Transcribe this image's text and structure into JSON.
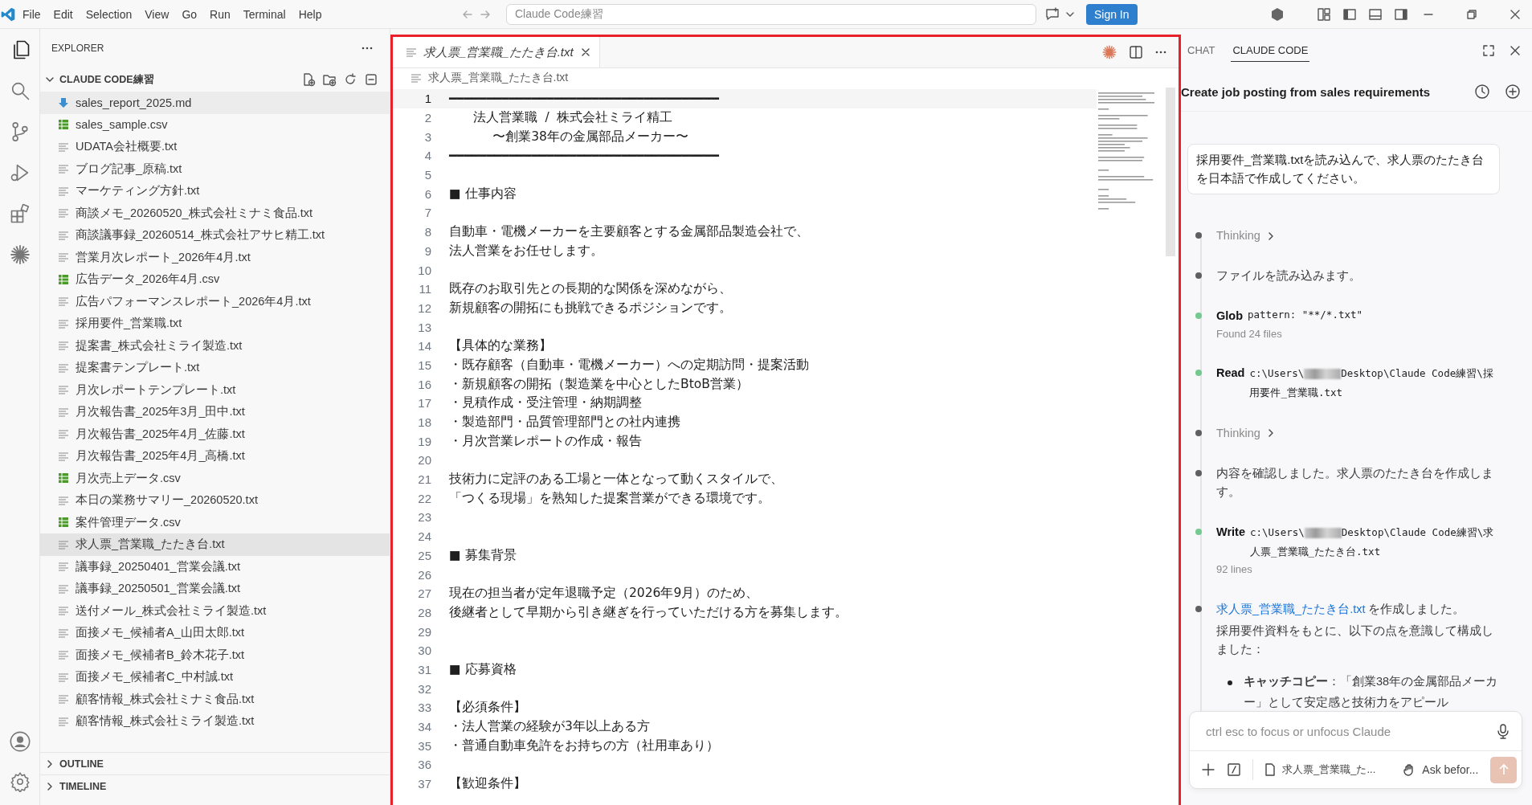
{
  "title_bar": {
    "menus": [
      "File",
      "Edit",
      "Selection",
      "View",
      "Go",
      "Run",
      "Terminal",
      "Help"
    ],
    "search": "Claude Code練習",
    "sign_in": "Sign In"
  },
  "activity_bar": {
    "items": [
      {
        "kind": "explorer",
        "selected": true
      },
      {
        "kind": "search",
        "selected": false
      },
      {
        "kind": "source-control",
        "selected": false
      },
      {
        "kind": "run",
        "selected": false
      },
      {
        "kind": "extensions",
        "selected": false
      },
      {
        "kind": "claude",
        "selected": false
      }
    ]
  },
  "explorer": {
    "title": "EXPLORER",
    "folder": {
      "name": "CLAUDE CODE練習",
      "expanded": true,
      "files": [
        {
          "name": "sales_report_2025.md",
          "kind": "md",
          "selected": false,
          "hovered": true
        },
        {
          "name": "sales_sample.csv",
          "kind": "csv",
          "selected": false,
          "hovered": false
        },
        {
          "name": "UDATA会社概要.txt",
          "kind": "txt",
          "selected": false,
          "hovered": false
        },
        {
          "name": "ブログ記事_原稿.txt",
          "kind": "txt",
          "selected": false,
          "hovered": false
        },
        {
          "name": "マーケティング方針.txt",
          "kind": "txt",
          "selected": false,
          "hovered": false
        },
        {
          "name": "商談メモ_20260520_株式会社ミナミ食品.txt",
          "kind": "txt",
          "selected": false,
          "hovered": false
        },
        {
          "name": "商談議事録_20260514_株式会社アサヒ精工.txt",
          "kind": "txt",
          "selected": false,
          "hovered": false
        },
        {
          "name": "営業月次レポート_2026年4月.txt",
          "kind": "txt",
          "selected": false,
          "hovered": false
        },
        {
          "name": "広告データ_2026年4月.csv",
          "kind": "csv",
          "selected": false,
          "hovered": false
        },
        {
          "name": "広告パフォーマンスレポート_2026年4月.txt",
          "kind": "txt",
          "selected": false,
          "hovered": false
        },
        {
          "name": "採用要件_営業職.txt",
          "kind": "txt",
          "selected": false,
          "hovered": false
        },
        {
          "name": "提案書_株式会社ミライ製造.txt",
          "kind": "txt",
          "selected": false,
          "hovered": false
        },
        {
          "name": "提案書テンプレート.txt",
          "kind": "txt",
          "selected": false,
          "hovered": false
        },
        {
          "name": "月次レポートテンプレート.txt",
          "kind": "txt",
          "selected": false,
          "hovered": false
        },
        {
          "name": "月次報告書_2025年3月_田中.txt",
          "kind": "txt",
          "selected": false,
          "hovered": false
        },
        {
          "name": "月次報告書_2025年4月_佐藤.txt",
          "kind": "txt",
          "selected": false,
          "hovered": false
        },
        {
          "name": "月次報告書_2025年4月_高橋.txt",
          "kind": "txt",
          "selected": false,
          "hovered": false
        },
        {
          "name": "月次売上データ.csv",
          "kind": "csv",
          "selected": false,
          "hovered": false
        },
        {
          "name": "本日の業務サマリー_20260520.txt",
          "kind": "txt",
          "selected": false,
          "hovered": false
        },
        {
          "name": "案件管理データ.csv",
          "kind": "csv",
          "selected": false,
          "hovered": false
        },
        {
          "name": "求人票_営業職_たたき台.txt",
          "kind": "txt",
          "selected": true,
          "hovered": false
        },
        {
          "name": "議事録_20250401_営業会議.txt",
          "kind": "txt",
          "selected": false,
          "hovered": false
        },
        {
          "name": "議事録_20250501_営業会議.txt",
          "kind": "txt",
          "selected": false,
          "hovered": false
        },
        {
          "name": "送付メール_株式会社ミライ製造.txt",
          "kind": "txt",
          "selected": false,
          "hovered": false
        },
        {
          "name": "面接メモ_候補者A_山田太郎.txt",
          "kind": "txt",
          "selected": false,
          "hovered": false
        },
        {
          "name": "面接メモ_候補者B_鈴木花子.txt",
          "kind": "txt",
          "selected": false,
          "hovered": false
        },
        {
          "name": "面接メモ_候補者C_中村誠.txt",
          "kind": "txt",
          "selected": false,
          "hovered": false
        },
        {
          "name": "顧客情報_株式会社ミナミ食品.txt",
          "kind": "txt",
          "selected": false,
          "hovered": false
        },
        {
          "name": "顧客情報_株式会社ミライ製造.txt",
          "kind": "txt",
          "selected": false,
          "hovered": false
        }
      ]
    },
    "sections": [
      {
        "name": "OUTLINE",
        "expanded": false
      },
      {
        "name": "TIMELINE",
        "expanded": false
      }
    ]
  },
  "editor": {
    "tab": {
      "label": "求人票_営業職_たたき台.txt",
      "preview": true
    },
    "breadcrumb": "求人票_営業職_たたき台.txt",
    "lines": [
      {
        "number": "1",
        "text": "━━━━━━━━━━━━━━━━━━━━━━━━━━━━━━━━━━━━",
        "current": true
      },
      {
        "number": "2",
        "text": "      法人営業職  /  株式会社ミライ精工",
        "current": false
      },
      {
        "number": "3",
        "text": "           〜創業38年の金属部品メーカー〜",
        "current": false
      },
      {
        "number": "4",
        "text": "━━━━━━━━━━━━━━━━━━━━━━━━━━━━━━━━━━━━",
        "current": false
      },
      {
        "number": "5",
        "current": false
      },
      {
        "number": "6",
        "text": "■ 仕事内容",
        "current": false
      },
      {
        "number": "7",
        "current": false
      },
      {
        "number": "8",
        "text": "自動車・電機メーカーを主要顧客とする金属部品製造会社で、",
        "current": false
      },
      {
        "number": "9",
        "text": "法人営業をお任せします。",
        "current": false
      },
      {
        "number": "10",
        "current": false
      },
      {
        "number": "11",
        "text": "既存のお取引先との長期的な関係を深めながら、",
        "current": false
      },
      {
        "number": "12",
        "text": "新規顧客の開拓にも挑戦できるポジションです。",
        "current": false
      },
      {
        "number": "13",
        "current": false
      },
      {
        "number": "14",
        "text": "【具体的な業務】",
        "current": false
      },
      {
        "number": "15",
        "text": "・既存顧客（自動車・電機メーカー）への定期訪問・提案活動",
        "current": false
      },
      {
        "number": "16",
        "text": "・新規顧客の開拓（製造業を中心としたBtoB営業）",
        "current": false
      },
      {
        "number": "17",
        "text": "・見積作成・受注管理・納期調整",
        "current": false
      },
      {
        "number": "18",
        "text": "・製造部門・品質管理部門との社内連携",
        "current": false
      },
      {
        "number": "19",
        "text": "・月次営業レポートの作成・報告",
        "current": false
      },
      {
        "number": "20",
        "current": false
      },
      {
        "number": "21",
        "text": "技術力に定評のある工場と一体となって動くスタイルで、",
        "current": false
      },
      {
        "number": "22",
        "text": "「つくる現場」を熟知した提案営業ができる環境です。",
        "current": false
      },
      {
        "number": "23",
        "current": false
      },
      {
        "number": "24",
        "current": false
      },
      {
        "number": "25",
        "text": "■ 募集背景",
        "current": false
      },
      {
        "number": "26",
        "current": false
      },
      {
        "number": "27",
        "text": "現在の担当者が定年退職予定（2026年9月）のため、",
        "current": false
      },
      {
        "number": "28",
        "text": "後継者として早期から引き継ぎを行っていただける方を募集します。",
        "current": false
      },
      {
        "number": "29",
        "current": false
      },
      {
        "number": "30",
        "current": false
      },
      {
        "number": "31",
        "text": "■ 応募資格",
        "current": false
      },
      {
        "number": "32",
        "current": false
      },
      {
        "number": "33",
        "text": "【必須条件】",
        "current": false
      },
      {
        "number": "34",
        "text": "・法人営業の経験が3年以上ある方",
        "current": false
      },
      {
        "number": "35",
        "text": "・普通自動車免許をお持ちの方（社用車あり）",
        "current": false
      },
      {
        "number": "36",
        "current": false
      },
      {
        "number": "37",
        "text": "【歓迎条件】",
        "current": false
      }
    ]
  },
  "chat": {
    "tabs": [
      {
        "label": "CHAT",
        "selected": false
      },
      {
        "label": "CLAUDE CODE",
        "selected": true
      }
    ],
    "title": "Create job posting from sales requirements",
    "user_message": "採用要件_営業職.txtを読み込んで、求人票のたたき台を日本語で作成してください。",
    "steps": [
      {
        "kind": "thinking",
        "label": "Thinking",
        "color": "#5f5f5f"
      },
      {
        "kind": "text",
        "text": "ファイルを読み込みます。",
        "color": "#5f5f5f"
      },
      {
        "kind": "tool",
        "name": "Glob",
        "args": "pattern: \"**/*.txt\"",
        "result": "Found 24 files",
        "color": "#74c991"
      },
      {
        "kind": "tool",
        "name": "Read",
        "path_start": "c:\\Users\\",
        "redacted": true,
        "path_end": "Desktop\\Claude Code練習\\採用要件_営業職.txt",
        "color": "#74c991"
      },
      {
        "kind": "thinking",
        "label": "Thinking",
        "color": "#5f5f5f"
      },
      {
        "kind": "text",
        "text": "内容を確認しました。求人票のたたき台を作成します。",
        "color": "#5f5f5f"
      },
      {
        "kind": "tool",
        "name": "Write",
        "path_start": "c:\\Users\\",
        "redacted": true,
        "path_end": "Desktop\\Claude Code練習\\求人票_営業職_たたき台.txt",
        "result": "92 lines",
        "color": "#74c991"
      },
      {
        "kind": "summary",
        "link": "求人票_営業職_たたき台.txt",
        "text": " を作成しました。",
        "paragraph": "採用要件資料をもとに、以下の点を意識して構成しました：",
        "bullets": [
          "**キャッチコピー**：「創業38年の金属部品メーカー」として安定感と技術力をアピール"
        ],
        "color": "#5f5f5f"
      }
    ],
    "input": {
      "placeholder": "ctrl esc to focus or unfocus Claude",
      "file_chip": "求人票_営業職_た...",
      "mode": "Ask befor...",
      "send_disabled": true
    }
  }
}
